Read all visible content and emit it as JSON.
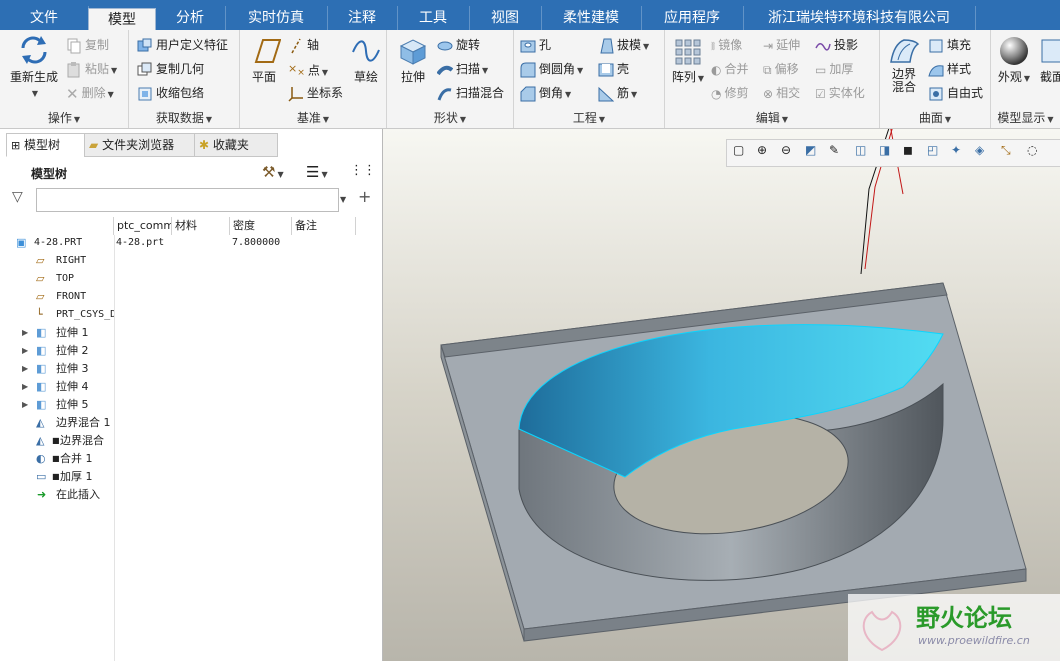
{
  "menu": {
    "tabs": [
      "文件",
      "模型",
      "分析",
      "实时仿真",
      "注释",
      "工具",
      "视图",
      "柔性建模",
      "应用程序",
      "浙江瑞埃特环境科技有限公司"
    ],
    "active": "模型",
    "file_bg": "#2d6fb4"
  },
  "ribbon": {
    "groups": {
      "operations": {
        "label": "操作",
        "regenerate": "重新生成",
        "copy": "复制",
        "paste": "粘贴",
        "delete": "删除"
      },
      "get_data": {
        "label": "获取数据",
        "udf": "用户定义特征",
        "copy_geom": "复制几何",
        "shrinkwrap": "收缩包络"
      },
      "datum": {
        "label": "基准",
        "plane": "平面",
        "axis": "轴",
        "point": "点",
        "csys": "坐标系",
        "sketch": "草绘"
      },
      "shapes": {
        "label": "形状",
        "extrude": "拉伸",
        "revolve": "旋转",
        "sweep": "扫描",
        "swept_blend": "扫描混合"
      },
      "engineering": {
        "label": "工程",
        "hole": "孔",
        "draft": "拔模",
        "round": "倒圆角",
        "shell": "壳",
        "chamfer": "倒角",
        "rib": "筋"
      },
      "editing": {
        "label": "编辑",
        "pattern": "阵列",
        "mirror": "镜像",
        "extend": "延伸",
        "project": "投影",
        "merge": "合并",
        "offset": "偏移",
        "thicken": "加厚",
        "trim": "修剪",
        "intersect": "相交",
        "solidify": "实体化"
      },
      "surfaces": {
        "label": "曲面",
        "boundary_blend": "边界\n混合",
        "fill": "填充",
        "style": "样式",
        "freestyle": "自由式"
      },
      "display": {
        "label": "模型显示",
        "appearance": "外观",
        "section": "截面"
      }
    }
  },
  "panel": {
    "tabs": [
      "模型树",
      "文件夹浏览器",
      "收藏夹"
    ],
    "title": "模型树",
    "filter_placeholder": "",
    "columns": [
      "ptc_common_name",
      "材料",
      "密度",
      "备注"
    ],
    "tree": [
      {
        "label": "4-28.PRT",
        "name_col": "4-28.prt",
        "density": "7.800000",
        "icon": "part-icon",
        "expandable": false
      },
      {
        "label": "RIGHT",
        "icon": "datum-plane-icon",
        "expandable": false
      },
      {
        "label": "TOP",
        "icon": "datum-plane-icon",
        "expandable": false
      },
      {
        "label": "FRONT",
        "icon": "datum-plane-icon",
        "expandable": false
      },
      {
        "label": "PRT_CSYS_DEF",
        "icon": "csys-icon",
        "expandable": false
      },
      {
        "label": "拉伸 1",
        "icon": "extrude-icon",
        "expandable": true
      },
      {
        "label": "拉伸 2",
        "icon": "extrude-icon",
        "expandable": true
      },
      {
        "label": "拉伸 3",
        "icon": "extrude-icon",
        "expandable": true
      },
      {
        "label": "拉伸 4",
        "icon": "extrude-icon",
        "expandable": true
      },
      {
        "label": "拉伸 5",
        "icon": "extrude-icon",
        "expandable": true
      },
      {
        "label": "边界混合 1",
        "icon": "boundary-blend-icon",
        "expandable": false
      },
      {
        "label": "边界混合",
        "icon": "boundary-blend-icon",
        "expandable": false
      },
      {
        "label": "合并 1",
        "icon": "merge-icon",
        "expandable": false
      },
      {
        "label": "加厚 1",
        "icon": "thicken-icon",
        "expandable": false
      },
      {
        "label": "在此插入",
        "icon": "insert-here-icon",
        "expandable": false
      }
    ]
  },
  "watermark": {
    "brand": "野火论坛",
    "url": "www.proewildfire.cn"
  },
  "colors": {
    "menubar": "#2d6fb4",
    "surface": "#3fb8e0",
    "base": "#a3aab1"
  }
}
